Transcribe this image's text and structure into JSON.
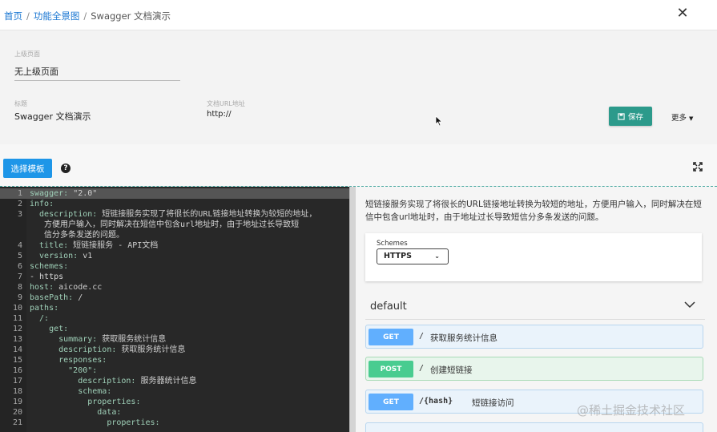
{
  "breadcrumb": {
    "home": "首页",
    "overview": "功能全景图",
    "current": "Swagger 文档演示"
  },
  "form": {
    "parent_label": "上级页面",
    "parent_value": "无上级页面",
    "title_label": "标题",
    "title_value": "Swagger 文档演示",
    "url_label": "文档URL地址",
    "url_value": "http://",
    "save_label": "保存",
    "more_label": "更多"
  },
  "toolbar": {
    "template_label": "选择模板"
  },
  "editor": {
    "lines": [
      {
        "n": "1",
        "key": "swagger",
        "val": " \"2.0\"",
        "indent": 0
      },
      {
        "n": "2",
        "key": "info",
        "val": "",
        "indent": 0
      },
      {
        "n": "3",
        "key": "description",
        "val": " 短链接服务实现了将很长的URL链接地址转换为较短的地址，",
        "indent": 2
      },
      {
        "n": "",
        "key": "",
        "val": "方便用户输入，同时解决在短信中包含url地址时，由于地址过长导致短",
        "indent": 3
      },
      {
        "n": "",
        "key": "",
        "val": "信分多条发送的问题。",
        "indent": 3
      },
      {
        "n": "4",
        "key": "title",
        "val": " 短链接服务 - API文档",
        "indent": 2
      },
      {
        "n": "5",
        "key": "version",
        "val": " v1",
        "indent": 2
      },
      {
        "n": "6",
        "key": "schemes",
        "val": "",
        "indent": 0
      },
      {
        "n": "7",
        "key": "",
        "val": "- https",
        "indent": 0
      },
      {
        "n": "8",
        "key": "host",
        "val": " aicode.cc",
        "indent": 0
      },
      {
        "n": "9",
        "key": "basePath",
        "val": " /",
        "indent": 0
      },
      {
        "n": "10",
        "key": "paths",
        "val": "",
        "indent": 0
      },
      {
        "n": "11",
        "key": "/",
        "val": "",
        "indent": 2
      },
      {
        "n": "12",
        "key": "get",
        "val": "",
        "indent": 4
      },
      {
        "n": "13",
        "key": "summary",
        "val": " 获取服务统计信息",
        "indent": 6
      },
      {
        "n": "14",
        "key": "description",
        "val": " 获取服务统计信息",
        "indent": 6
      },
      {
        "n": "15",
        "key": "responses",
        "val": "",
        "indent": 6
      },
      {
        "n": "16",
        "key": "\"200\"",
        "val": "",
        "indent": 8
      },
      {
        "n": "17",
        "key": "description",
        "val": " 服务器统计信息",
        "indent": 10
      },
      {
        "n": "18",
        "key": "schema",
        "val": "",
        "indent": 10
      },
      {
        "n": "19",
        "key": "properties",
        "val": "",
        "indent": 12
      },
      {
        "n": "20",
        "key": "data",
        "val": "",
        "indent": 14
      },
      {
        "n": "21",
        "key": "properties",
        "val": "",
        "indent": 16
      }
    ]
  },
  "preview": {
    "description": "短链接服务实现了将很长的URL链接地址转换为较短的地址，方便用户输入，同时解决在短信中包含url地址时，由于地址过长导致短信分多条发送的问题。",
    "schemes_label": "Schemes",
    "scheme_selected": "HTTPS",
    "tag_name": "default",
    "operations": [
      {
        "method": "GET",
        "path": "/",
        "summary": "获取服务统计信息"
      },
      {
        "method": "POST",
        "path": "/",
        "summary": "创建短链接"
      },
      {
        "method": "GET",
        "path": "/{hash}",
        "summary": "短链接访问"
      }
    ]
  },
  "watermark": "@稀土掘金技术社区",
  "colors": {
    "accent_blue": "#1e96e8",
    "save_green": "#2c9a8b",
    "get_blue": "#61affe",
    "post_green": "#49cc90"
  }
}
